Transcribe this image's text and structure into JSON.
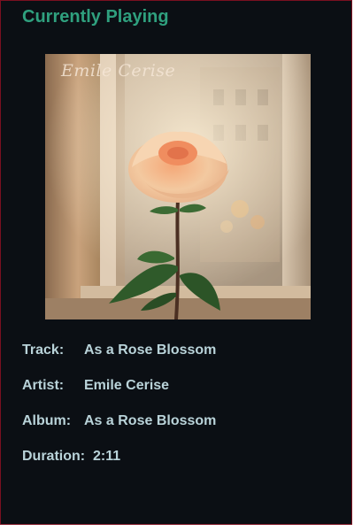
{
  "player": {
    "heading": "Currently Playing",
    "cover_art": {
      "artist_text": "Emile Cerise",
      "description_icon": "rose-in-window"
    },
    "fields": {
      "track_label": "Track:",
      "track_value": "As a Rose Blossom",
      "artist_label": "Artist:",
      "artist_value": "Emile Cerise",
      "album_label": "Album:",
      "album_value": "As a Rose Blossom",
      "duration_label": "Duration:",
      "duration_value": "2:11"
    },
    "colors": {
      "background": "#0b0f14",
      "heading": "#2fa07e",
      "text": "#b9d3d9",
      "border": "#7a1020"
    }
  }
}
